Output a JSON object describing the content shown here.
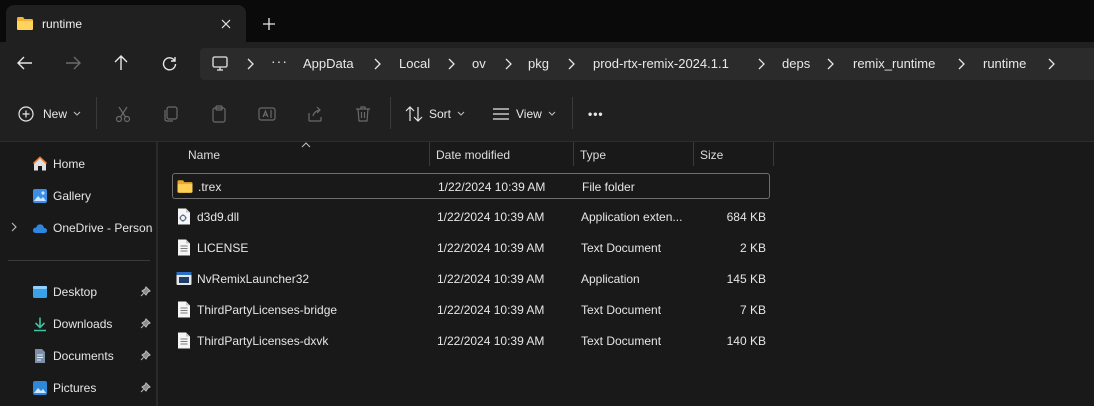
{
  "tab": {
    "title": "runtime",
    "icon": "folder-icon"
  },
  "address": {
    "crumbs": [
      "AppData",
      "Local",
      "ov",
      "pkg",
      "prod-rtx-remix-2024.1.1",
      "deps",
      "remix_runtime",
      "runtime"
    ],
    "overflow": "···"
  },
  "toolbar": {
    "new_label": "New",
    "sort_label": "Sort",
    "view_label": "View",
    "more_label": "•••"
  },
  "sidebar": {
    "items": [
      {
        "label": "Home",
        "icon": "home-icon"
      },
      {
        "label": "Gallery",
        "icon": "gallery-icon"
      },
      {
        "label": "OneDrive - Persona",
        "icon": "cloud-icon"
      },
      {
        "label": "Desktop",
        "icon": "desktop-icon"
      },
      {
        "label": "Downloads",
        "icon": "download-icon"
      },
      {
        "label": "Documents",
        "icon": "documents-icon"
      },
      {
        "label": "Pictures",
        "icon": "pictures-icon"
      }
    ]
  },
  "columns": {
    "name": "Name",
    "date": "Date modified",
    "type": "Type",
    "size": "Size"
  },
  "files": [
    {
      "name": ".trex",
      "date": "1/22/2024 10:39 AM",
      "type": "File folder",
      "size": "",
      "icon": "folder-icon"
    },
    {
      "name": "d3d9.dll",
      "date": "1/22/2024 10:39 AM",
      "type": "Application exten...",
      "size": "684 KB",
      "icon": "dll-file-icon"
    },
    {
      "name": "LICENSE",
      "date": "1/22/2024 10:39 AM",
      "type": "Text Document",
      "size": "2 KB",
      "icon": "text-file-icon"
    },
    {
      "name": "NvRemixLauncher32",
      "date": "1/22/2024 10:39 AM",
      "type": "Application",
      "size": "145 KB",
      "icon": "application-icon"
    },
    {
      "name": "ThirdPartyLicenses-bridge",
      "date": "1/22/2024 10:39 AM",
      "type": "Text Document",
      "size": "7 KB",
      "icon": "text-file-icon"
    },
    {
      "name": "ThirdPartyLicenses-dxvk",
      "date": "1/22/2024 10:39 AM",
      "type": "Text Document",
      "size": "140 KB",
      "icon": "text-file-icon"
    }
  ]
}
